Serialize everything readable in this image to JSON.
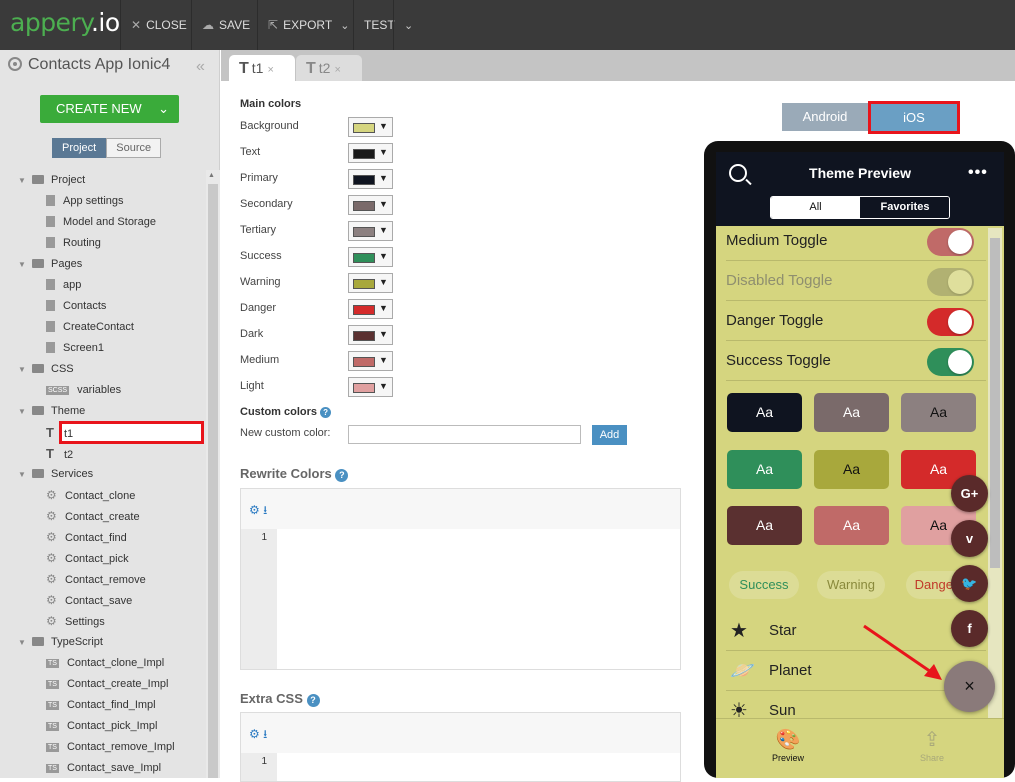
{
  "topbar": {
    "logo_main": "appery",
    "logo_suffix": ".io",
    "close_label": "CLOSE",
    "save_label": "SAVE",
    "export_label": "EXPORT",
    "test_label": "TEST"
  },
  "sidebar": {
    "project_title": "Contacts App Ionic4",
    "create_new_label": "CREATE NEW",
    "tabs": [
      "Project",
      "Source"
    ],
    "tree": [
      {
        "label": "Project",
        "kind": "folder"
      },
      {
        "label": "App settings",
        "kind": "file"
      },
      {
        "label": "Model and Storage",
        "kind": "file"
      },
      {
        "label": "Routing",
        "kind": "file"
      },
      {
        "label": "Pages",
        "kind": "folder"
      },
      {
        "label": "app",
        "kind": "file"
      },
      {
        "label": "Contacts",
        "kind": "file"
      },
      {
        "label": "CreateContact",
        "kind": "file"
      },
      {
        "label": "Screen1",
        "kind": "file"
      },
      {
        "label": "CSS",
        "kind": "folder"
      },
      {
        "label": "variables",
        "kind": "scss",
        "badge": "SCSS"
      },
      {
        "label": "Theme",
        "kind": "folder"
      },
      {
        "label": "t1",
        "kind": "theme"
      },
      {
        "label": "t2",
        "kind": "theme"
      },
      {
        "label": "Services",
        "kind": "folder"
      },
      {
        "label": "Contact_clone",
        "kind": "gear"
      },
      {
        "label": "Contact_create",
        "kind": "gear"
      },
      {
        "label": "Contact_find",
        "kind": "gear"
      },
      {
        "label": "Contact_pick",
        "kind": "gear"
      },
      {
        "label": "Contact_remove",
        "kind": "gear"
      },
      {
        "label": "Contact_save",
        "kind": "gear"
      },
      {
        "label": "Settings",
        "kind": "gear"
      },
      {
        "label": "TypeScript",
        "kind": "folder"
      },
      {
        "label": "Contact_clone_Impl",
        "kind": "ts",
        "badge": "TS"
      },
      {
        "label": "Contact_create_Impl",
        "kind": "ts",
        "badge": "TS"
      },
      {
        "label": "Contact_find_Impl",
        "kind": "ts",
        "badge": "TS"
      },
      {
        "label": "Contact_pick_Impl",
        "kind": "ts",
        "badge": "TS"
      },
      {
        "label": "Contact_remove_Impl",
        "kind": "ts",
        "badge": "TS"
      },
      {
        "label": "Contact_save_Impl",
        "kind": "ts",
        "badge": "TS"
      }
    ]
  },
  "editor_tabs": [
    {
      "label": "t1",
      "active": true
    },
    {
      "label": "t2",
      "active": false
    }
  ],
  "main": {
    "main_colors_heading": "Main colors",
    "colors": [
      {
        "label": "Background",
        "hex": "#d5d57f"
      },
      {
        "label": "Text",
        "hex": "#1a1a1a"
      },
      {
        "label": "Primary",
        "hex": "#0f1420"
      },
      {
        "label": "Secondary",
        "hex": "#7a6a6a"
      },
      {
        "label": "Tertiary",
        "hex": "#8c8080"
      },
      {
        "label": "Success",
        "hex": "#2f8f5a"
      },
      {
        "label": "Warning",
        "hex": "#a8a83c"
      },
      {
        "label": "Danger",
        "hex": "#d42a2a"
      },
      {
        "label": "Dark",
        "hex": "#5a3030"
      },
      {
        "label": "Medium",
        "hex": "#c06a68"
      },
      {
        "label": "Light",
        "hex": "#e0a0a0"
      }
    ],
    "custom_colors_heading": "Custom colors",
    "new_custom_color_label": "New custom color:",
    "add_label": "Add",
    "rewrite_colors_heading": "Rewrite Colors",
    "extra_css_heading": "Extra CSS",
    "line_number": "1"
  },
  "preview": {
    "android_label": "Android",
    "ios_label": "iOS",
    "title": "Theme Preview",
    "segments": [
      "All",
      "Favorites"
    ],
    "toggles": [
      {
        "label": "Medium Toggle",
        "color": "#c06a68",
        "disabled": false
      },
      {
        "label": "Disabled Toggle",
        "color": "#9a9a6a",
        "disabled": true
      },
      {
        "label": "Danger Toggle",
        "color": "#d42a2a",
        "disabled": false
      },
      {
        "label": "Success Toggle",
        "color": "#2f8f5a",
        "disabled": false
      }
    ],
    "buttons": [
      {
        "label": "Aa",
        "bg": "#0f1420",
        "fg": "#ffffff"
      },
      {
        "label": "Aa",
        "bg": "#7a6a6a",
        "fg": "#ffffff"
      },
      {
        "label": "Aa",
        "bg": "#8c8080",
        "fg": "#111111"
      },
      {
        "label": "Aa",
        "bg": "#2f8f5a",
        "fg": "#ffffff"
      },
      {
        "label": "Aa",
        "bg": "#a8a83c",
        "fg": "#111111"
      },
      {
        "label": "Aa",
        "bg": "#d42a2a",
        "fg": "#ffffff"
      },
      {
        "label": "Aa",
        "bg": "#5a3030",
        "fg": "#ffffff"
      },
      {
        "label": "Aa",
        "bg": "#c06a68",
        "fg": "#ffffff"
      },
      {
        "label": "Aa",
        "bg": "#e0a0a0",
        "fg": "#111111"
      }
    ],
    "chips": [
      {
        "label": "Success",
        "color": "#2f8f5a"
      },
      {
        "label": "Warning",
        "color": "#8a8a3c"
      },
      {
        "label": "Danger",
        "color": "#c03a2a"
      }
    ],
    "list": [
      {
        "label": "Star",
        "icon": "star-icon",
        "glyph": "★"
      },
      {
        "label": "Planet",
        "icon": "planet-icon",
        "glyph": "🪐"
      },
      {
        "label": "Sun",
        "icon": "sun-icon",
        "glyph": "☀"
      }
    ],
    "footer": [
      {
        "label": "Preview",
        "icon": "palette-icon"
      },
      {
        "label": "Share",
        "icon": "share-icon"
      }
    ],
    "social_fabs": [
      {
        "label": "G+",
        "icon": "google-plus-icon"
      },
      {
        "label": "v",
        "icon": "vimeo-icon"
      },
      {
        "label": "🐦",
        "icon": "twitter-icon"
      },
      {
        "label": "f",
        "icon": "facebook-icon"
      }
    ],
    "fab_close_label": "×"
  }
}
